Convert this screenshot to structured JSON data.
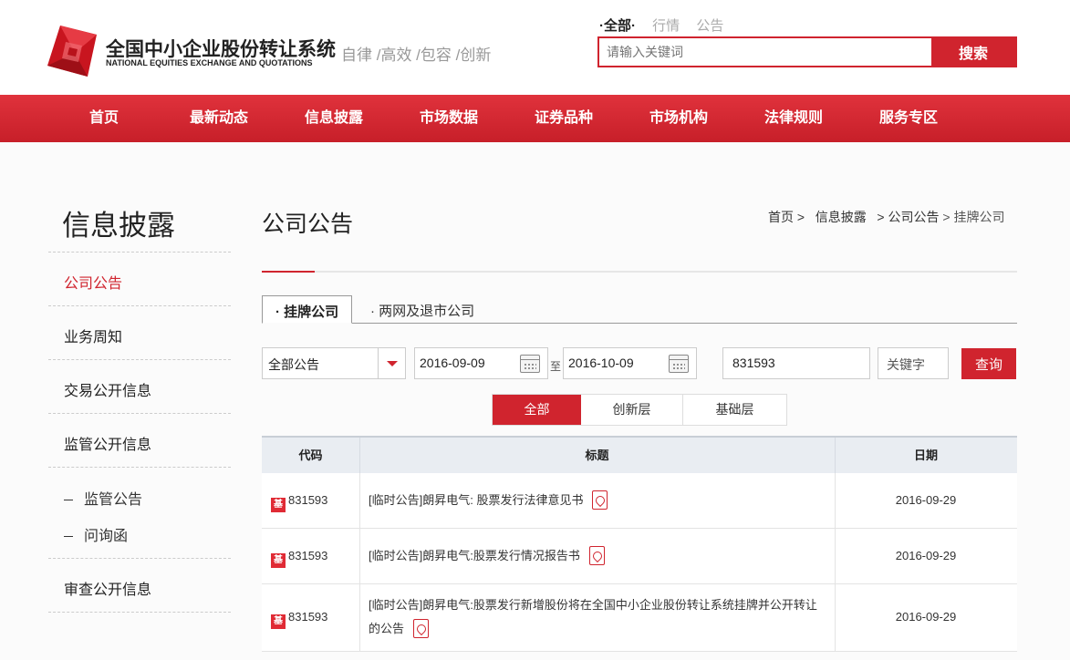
{
  "header": {
    "logo_cn": "全国中小企业股份转让系统",
    "logo_en": "NATIONAL EQUITIES EXCHANGE AND QUOTATIONS",
    "slogan": "自律 /高效 /包容 /创新",
    "search_tabs": [
      "·全部·",
      "行情",
      "公告"
    ],
    "search_placeholder": "请输入关键词",
    "search_button": "搜索"
  },
  "nav": [
    "首页",
    "最新动态",
    "信息披露",
    "市场数据",
    "证券品种",
    "市场机构",
    "法律规则",
    "服务专区"
  ],
  "sidebar": {
    "title": "信息披露",
    "items": [
      "公司公告",
      "业务周知",
      "交易公开信息",
      "监管公开信息"
    ],
    "sub_items": [
      "监管公告",
      "问询函"
    ],
    "last_item": "审查公开信息"
  },
  "main": {
    "title": "公司公告",
    "breadcrumb": [
      "首页 >",
      "信息披露",
      "> 公司公告",
      "> 挂牌公司"
    ],
    "tabs": [
      "· 挂牌公司",
      "· 两网及退市公司"
    ]
  },
  "filters": {
    "type_select": "全部公告",
    "date_from": "2016-09-09",
    "date_sep": "至",
    "date_to": "2016-10-09",
    "code": "831593",
    "keyword_placeholder": "关键字",
    "query_button": "查询",
    "levels": [
      "全部",
      "创新层",
      "基础层"
    ],
    "active_level": "全部"
  },
  "table": {
    "headers": [
      "代码",
      "标题",
      "日期"
    ],
    "badge": "基",
    "rows": [
      {
        "code": "831593",
        "title": "[临时公告]朗昇电气: 股票发行法律意见书",
        "date": "2016-09-29"
      },
      {
        "code": "831593",
        "title": "[临时公告]朗昇电气:股票发行情况报告书",
        "date": "2016-09-29"
      },
      {
        "code": "831593",
        "title": "[临时公告]朗昇电气:股票发行新增股份将在全国中小企业股份转让系统挂牌并公开转让的公告",
        "date": "2016-09-29"
      }
    ]
  }
}
